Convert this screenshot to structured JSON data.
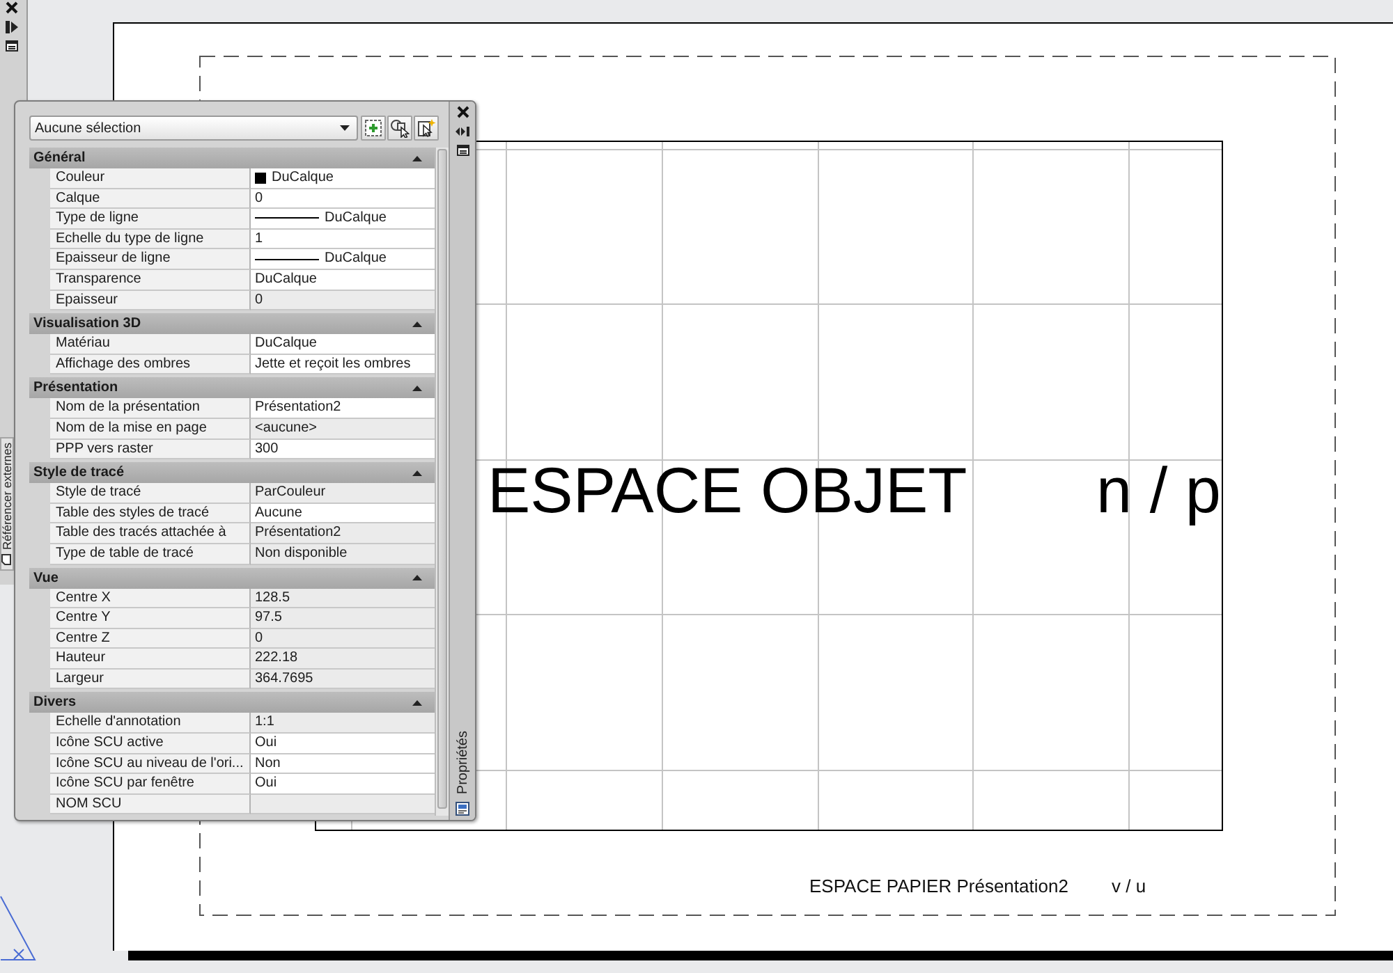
{
  "external_references_palette": {
    "tab_label": "Référencer externes"
  },
  "properties_palette": {
    "title": "Propriétés",
    "selection": "Aucune sélection",
    "sections": [
      {
        "title": "Général",
        "expanded": true,
        "rows": [
          {
            "label": "Couleur",
            "value": "DuCalque",
            "kind": "color",
            "editable": true
          },
          {
            "label": "Calque",
            "value": "0",
            "kind": "text",
            "editable": true
          },
          {
            "label": "Type de ligne",
            "value": "DuCalque",
            "kind": "line",
            "editable": true
          },
          {
            "label": "Echelle du type de ligne",
            "value": "1",
            "kind": "text",
            "editable": true
          },
          {
            "label": "Epaisseur de ligne",
            "value": "DuCalque",
            "kind": "line",
            "editable": true
          },
          {
            "label": "Transparence",
            "value": "DuCalque",
            "kind": "text",
            "editable": true
          },
          {
            "label": "Epaisseur",
            "value": "0",
            "kind": "text",
            "editable": false
          }
        ]
      },
      {
        "title": "Visualisation 3D",
        "expanded": true,
        "rows": [
          {
            "label": "Matériau",
            "value": "DuCalque",
            "kind": "text",
            "editable": true
          },
          {
            "label": "Affichage des ombres",
            "value": "Jette et reçoit les ombres",
            "kind": "text",
            "editable": true
          }
        ]
      },
      {
        "title": "Présentation",
        "expanded": true,
        "rows": [
          {
            "label": "Nom de la présentation",
            "value": "Présentation2",
            "kind": "text",
            "editable": true
          },
          {
            "label": "Nom de la mise en page",
            "value": "<aucune>",
            "kind": "text",
            "editable": false
          },
          {
            "label": "PPP vers raster",
            "value": "300",
            "kind": "text",
            "editable": true
          }
        ]
      },
      {
        "title": "Style de tracé",
        "expanded": true,
        "rows": [
          {
            "label": "Style de tracé",
            "value": "ParCouleur",
            "kind": "text",
            "editable": false
          },
          {
            "label": "Table des styles de tracé",
            "value": "Aucune",
            "kind": "text",
            "editable": true
          },
          {
            "label": "Table des tracés attachée à",
            "value": "Présentation2",
            "kind": "text",
            "editable": false
          },
          {
            "label": "Type de table de tracé",
            "value": "Non disponible",
            "kind": "text",
            "editable": false
          }
        ]
      },
      {
        "title": "Vue",
        "expanded": true,
        "rows": [
          {
            "label": "Centre X",
            "value": "128.5",
            "kind": "text",
            "editable": false
          },
          {
            "label": "Centre Y",
            "value": "97.5",
            "kind": "text",
            "editable": false
          },
          {
            "label": "Centre Z",
            "value": "0",
            "kind": "text",
            "editable": false
          },
          {
            "label": "Hauteur",
            "value": "222.18",
            "kind": "text",
            "editable": false
          },
          {
            "label": "Largeur",
            "value": "364.7695",
            "kind": "text",
            "editable": false
          }
        ]
      },
      {
        "title": "Divers",
        "expanded": true,
        "rows": [
          {
            "label": "Echelle d'annotation",
            "value": "1:1",
            "kind": "text",
            "editable": false
          },
          {
            "label": "Icône SCU active",
            "value": "Oui",
            "kind": "text",
            "editable": true
          },
          {
            "label": "Icône SCU au niveau de l'ori...",
            "value": "Non",
            "kind": "text",
            "editable": true
          },
          {
            "label": "Icône SCU par fenêtre",
            "value": "Oui",
            "kind": "text",
            "editable": true
          },
          {
            "label": "NOM SCU",
            "kind": "text",
            "editable": false
          }
        ]
      }
    ]
  },
  "drawing": {
    "model_space_label": "ESPACE OBJET",
    "model_space_tag": "n / p",
    "paper_space_label": "ESPACE PAPIER Présentation2",
    "paper_space_tag": "v / u"
  }
}
